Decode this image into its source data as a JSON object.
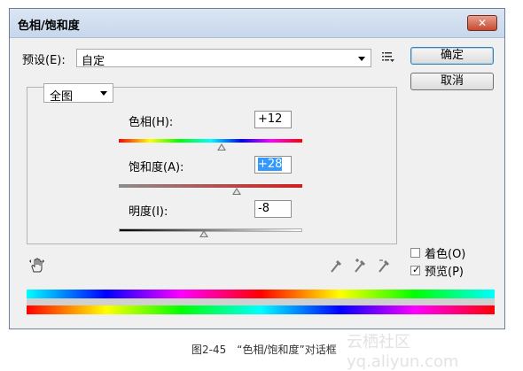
{
  "window": {
    "title": "色相/饱和度",
    "close_glyph": "✕"
  },
  "preset": {
    "label": "预设(E):",
    "value": "自定"
  },
  "buttons": {
    "ok": "确定",
    "cancel": "取消"
  },
  "range": {
    "value": "全图"
  },
  "sliders": [
    {
      "label": "色相(H):",
      "value": "+12"
    },
    {
      "label": "饱和度(A):",
      "value": "+28"
    },
    {
      "label": "明度(I):",
      "value": "-8"
    }
  ],
  "options": {
    "colorize": {
      "label": "着色(O)",
      "checked": false
    },
    "preview": {
      "label": "预览(P)",
      "checked": true,
      "mark": "✓"
    }
  },
  "caption": "图2-45　“色相/饱和度”对话框",
  "watermark": "云栖社区 yq.aliyun.com"
}
